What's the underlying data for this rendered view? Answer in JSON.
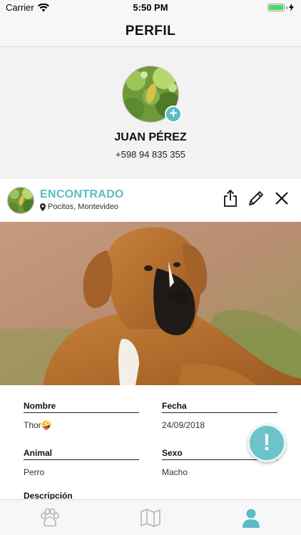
{
  "status_bar": {
    "carrier": "Carrier",
    "time": "5:50 PM",
    "wifi_icon": "wifi-icon",
    "battery_icon": "battery-icon"
  },
  "nav": {
    "title": "PERFIL"
  },
  "profile": {
    "name": "JUAN PÉREZ",
    "phone": "+598 94 835 355",
    "add_photo_icon": "plus-icon"
  },
  "report": {
    "status": "ENCONTRADO",
    "location": "Pocitos, Montevideo",
    "location_icon": "map-pin-icon",
    "actions": [
      "share-icon",
      "pencil-icon",
      "close-icon"
    ],
    "fields": {
      "nombre_label": "Nombre",
      "nombre_value": "Thor🤪",
      "fecha_label": "Fecha",
      "fecha_value": "24/09/2018",
      "animal_label": "Animal",
      "animal_value": "Perro",
      "sexo_label": "Sexo",
      "sexo_value": "Macho",
      "descripcion_label": "Descripción"
    },
    "alert_button_label": "!"
  },
  "tab_bar": {
    "tabs": [
      {
        "icon": "paw-icon",
        "active": false
      },
      {
        "icon": "map-icon",
        "active": false
      },
      {
        "icon": "person-icon",
        "active": true
      }
    ]
  },
  "colors": {
    "accent": "#5bbcc4",
    "inactive_icon": "#b5b5b5"
  }
}
